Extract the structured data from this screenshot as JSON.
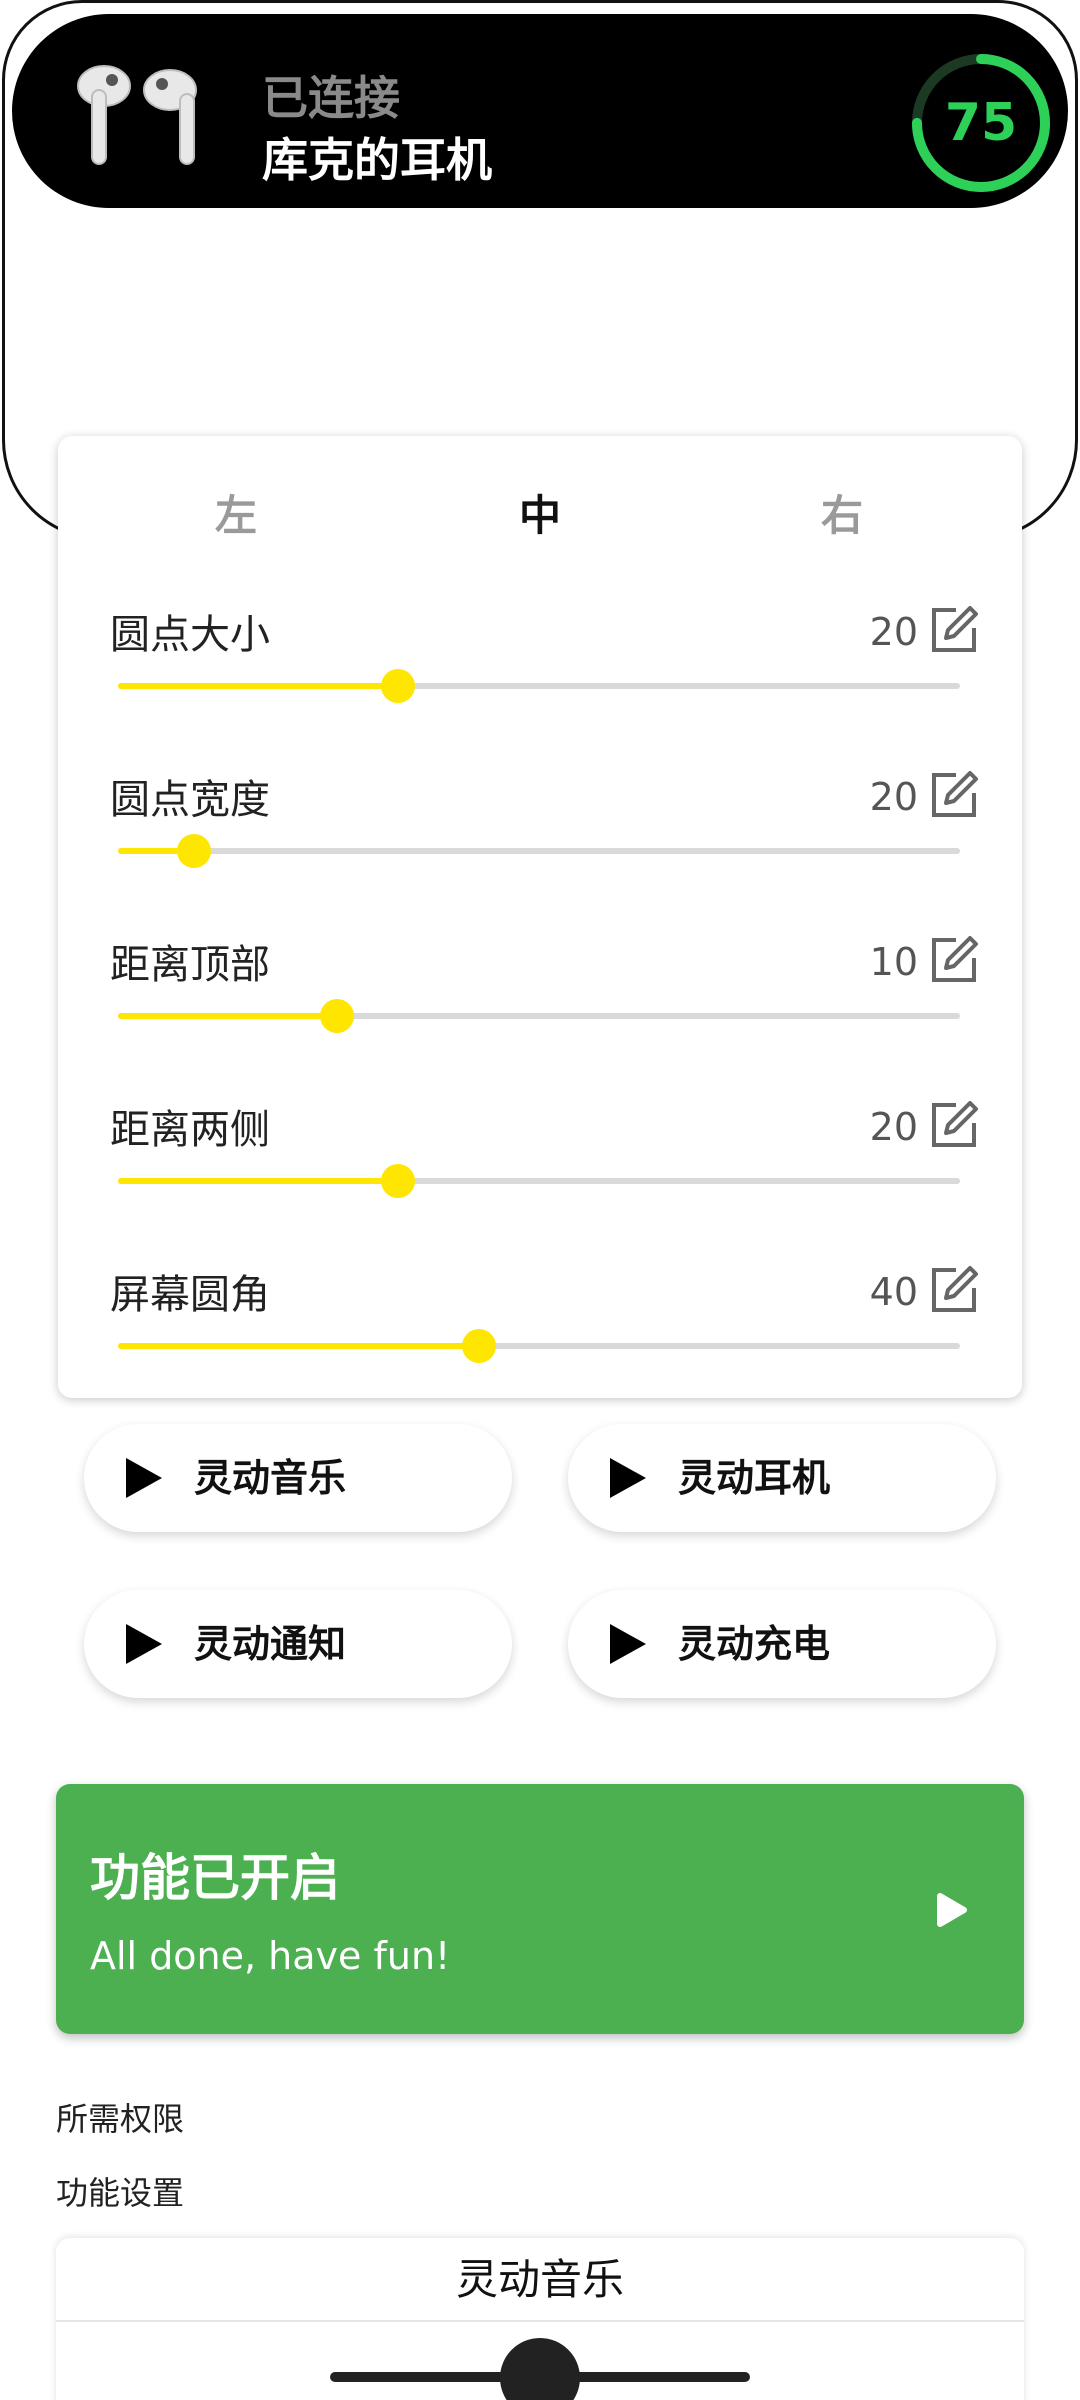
{
  "island": {
    "status": "已连接",
    "device_name": "库克的耳机",
    "battery": "75",
    "battery_level": 0.75,
    "battery_color": "#2ed158"
  },
  "tabs": [
    {
      "label": "左",
      "active": false
    },
    {
      "label": "中",
      "active": true
    },
    {
      "label": "右",
      "active": false
    }
  ],
  "settings": [
    {
      "label": "圆点大小",
      "value": "20",
      "slider_fraction": 0.333
    },
    {
      "label": "圆点宽度",
      "value": "20",
      "slider_fraction": 0.09
    },
    {
      "label": "距离顶部",
      "value": "10",
      "slider_fraction": 0.26
    },
    {
      "label": "距离两侧",
      "value": "20",
      "slider_fraction": 0.333
    },
    {
      "label": "屏幕圆角",
      "value": "40",
      "slider_fraction": 0.429
    }
  ],
  "slider_color": "#ffe600",
  "feature_buttons": [
    {
      "label": "灵动音乐"
    },
    {
      "label": "灵动耳机"
    },
    {
      "label": "灵动通知"
    },
    {
      "label": "灵动充电"
    }
  ],
  "banner": {
    "title": "功能已开启",
    "subtitle": "All done, have fun!",
    "color": "#4caf50"
  },
  "sections": {
    "permissions": "所需权限",
    "settings": "功能设置"
  },
  "bottom_card": {
    "title": "灵动音乐"
  },
  "icons": {
    "earbuds": "airpods-icon",
    "edit": "edit-icon",
    "play": "play-icon"
  }
}
